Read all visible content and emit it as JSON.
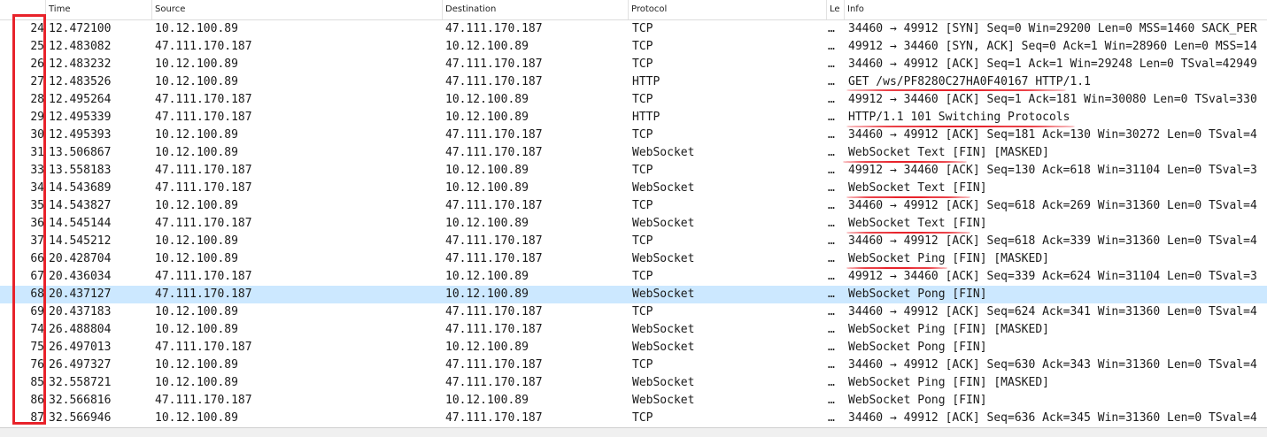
{
  "columns": {
    "no": "",
    "time": "Time",
    "source": "Source",
    "destination": "Destination",
    "protocol": "Protocol",
    "length": "Le",
    "info": "Info"
  },
  "colors": {
    "selected_row": "#cce8ff",
    "annotation": "#e8232b"
  },
  "selected_row_no": "68",
  "packets": [
    {
      "no": "24",
      "time": "12.472100",
      "source": "10.12.100.89",
      "destination": "47.111.170.187",
      "protocol": "TCP",
      "length": "…",
      "info": "34460 → 49912 [SYN] Seq=0 Win=29200 Len=0 MSS=1460 SACK_PER"
    },
    {
      "no": "25",
      "time": "12.483082",
      "source": "47.111.170.187",
      "destination": "10.12.100.89",
      "protocol": "TCP",
      "length": "…",
      "info": "49912 → 34460 [SYN, ACK] Seq=0 Ack=1 Win=28960 Len=0 MSS=14"
    },
    {
      "no": "26",
      "time": "12.483232",
      "source": "10.12.100.89",
      "destination": "47.111.170.187",
      "protocol": "TCP",
      "length": "…",
      "info": "34460 → 49912 [ACK] Seq=1 Ack=1 Win=29248 Len=0 TSval=42949"
    },
    {
      "no": "27",
      "time": "12.483526",
      "source": "10.12.100.89",
      "destination": "47.111.170.187",
      "protocol": "HTTP",
      "length": "…",
      "info": "GET /ws/PF8280C27HA0F40167 HTTP/1.1"
    },
    {
      "no": "28",
      "time": "12.495264",
      "source": "47.111.170.187",
      "destination": "10.12.100.89",
      "protocol": "TCP",
      "length": "…",
      "info": "49912 → 34460 [ACK] Seq=1 Ack=181 Win=30080 Len=0 TSval=330"
    },
    {
      "no": "29",
      "time": "12.495339",
      "source": "47.111.170.187",
      "destination": "10.12.100.89",
      "protocol": "HTTP",
      "length": "…",
      "info": "HTTP/1.1 101 Switching Protocols"
    },
    {
      "no": "30",
      "time": "12.495393",
      "source": "10.12.100.89",
      "destination": "47.111.170.187",
      "protocol": "TCP",
      "length": "…",
      "info": "34460 → 49912 [ACK] Seq=181 Ack=130 Win=30272 Len=0 TSval=4"
    },
    {
      "no": "31",
      "time": "13.506867",
      "source": "10.12.100.89",
      "destination": "47.111.170.187",
      "protocol": "WebSocket",
      "length": "…",
      "info": "WebSocket Text [FIN] [MASKED]"
    },
    {
      "no": "33",
      "time": "13.558183",
      "source": "47.111.170.187",
      "destination": "10.12.100.89",
      "protocol": "TCP",
      "length": "…",
      "info": "49912 → 34460 [ACK] Seq=130 Ack=618 Win=31104 Len=0 TSval=3"
    },
    {
      "no": "34",
      "time": "14.543689",
      "source": "47.111.170.187",
      "destination": "10.12.100.89",
      "protocol": "WebSocket",
      "length": "…",
      "info": "WebSocket Text [FIN]"
    },
    {
      "no": "35",
      "time": "14.543827",
      "source": "10.12.100.89",
      "destination": "47.111.170.187",
      "protocol": "TCP",
      "length": "…",
      "info": "34460 → 49912 [ACK] Seq=618 Ack=269 Win=31360 Len=0 TSval=4"
    },
    {
      "no": "36",
      "time": "14.545144",
      "source": "47.111.170.187",
      "destination": "10.12.100.89",
      "protocol": "WebSocket",
      "length": "…",
      "info": "WebSocket Text [FIN]"
    },
    {
      "no": "37",
      "time": "14.545212",
      "source": "10.12.100.89",
      "destination": "47.111.170.187",
      "protocol": "TCP",
      "length": "…",
      "info": "34460 → 49912 [ACK] Seq=618 Ack=339 Win=31360 Len=0 TSval=4"
    },
    {
      "no": "66",
      "time": "20.428704",
      "source": "10.12.100.89",
      "destination": "47.111.170.187",
      "protocol": "WebSocket",
      "length": "…",
      "info": "WebSocket Ping [FIN] [MASKED]"
    },
    {
      "no": "67",
      "time": "20.436034",
      "source": "47.111.170.187",
      "destination": "10.12.100.89",
      "protocol": "TCP",
      "length": "…",
      "info": "49912 → 34460 [ACK] Seq=339 Ack=624 Win=31104 Len=0 TSval=3"
    },
    {
      "no": "68",
      "time": "20.437127",
      "source": "47.111.170.187",
      "destination": "10.12.100.89",
      "protocol": "WebSocket",
      "length": "…",
      "info": "WebSocket Pong [FIN]"
    },
    {
      "no": "69",
      "time": "20.437183",
      "source": "10.12.100.89",
      "destination": "47.111.170.187",
      "protocol": "TCP",
      "length": "…",
      "info": "34460 → 49912 [ACK] Seq=624 Ack=341 Win=31360 Len=0 TSval=4"
    },
    {
      "no": "74",
      "time": "26.488804",
      "source": "10.12.100.89",
      "destination": "47.111.170.187",
      "protocol": "WebSocket",
      "length": "…",
      "info": "WebSocket Ping [FIN] [MASKED]"
    },
    {
      "no": "75",
      "time": "26.497013",
      "source": "47.111.170.187",
      "destination": "10.12.100.89",
      "protocol": "WebSocket",
      "length": "…",
      "info": "WebSocket Pong [FIN]"
    },
    {
      "no": "76",
      "time": "26.497327",
      "source": "10.12.100.89",
      "destination": "47.111.170.187",
      "protocol": "TCP",
      "length": "…",
      "info": "34460 → 49912 [ACK] Seq=630 Ack=343 Win=31360 Len=0 TSval=4"
    },
    {
      "no": "85",
      "time": "32.558721",
      "source": "10.12.100.89",
      "destination": "47.111.170.187",
      "protocol": "WebSocket",
      "length": "…",
      "info": "WebSocket Ping [FIN] [MASKED]"
    },
    {
      "no": "86",
      "time": "32.566816",
      "source": "47.111.170.187",
      "destination": "10.12.100.89",
      "protocol": "WebSocket",
      "length": "…",
      "info": "WebSocket Pong [FIN]"
    },
    {
      "no": "87",
      "time": "32.566946",
      "source": "10.12.100.89",
      "destination": "47.111.170.187",
      "protocol": "TCP",
      "length": "…",
      "info": "34460 → 49912 [ACK] Seq=636 Ack=345 Win=31360 Len=0 TSval=4"
    }
  ]
}
